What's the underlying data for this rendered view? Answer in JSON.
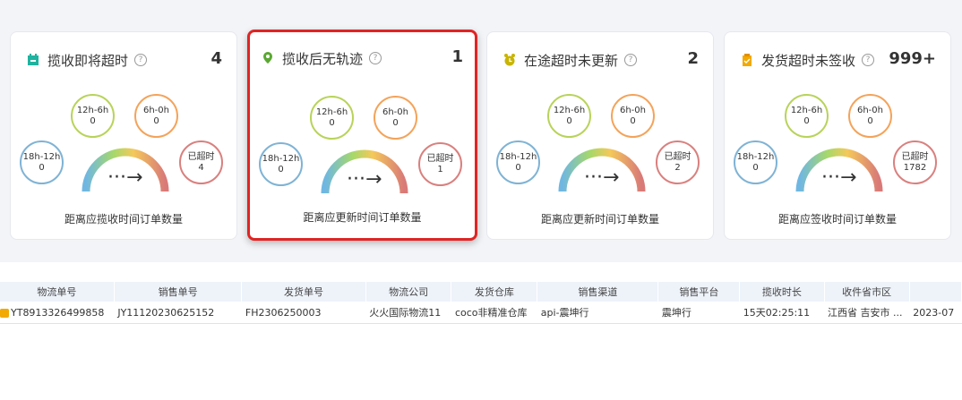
{
  "cards": [
    {
      "title": "揽收即将超时",
      "help": "?",
      "count": "4",
      "caption": "距离应揽收时间订单数量",
      "icon": "calendar-icon",
      "iconColor": "#1fb3a0",
      "buckets": [
        {
          "label": "18h-12h",
          "value": "0"
        },
        {
          "label": "12h-6h",
          "value": "0"
        },
        {
          "label": "6h-0h",
          "value": "0"
        },
        {
          "label": "已超时",
          "value": "4"
        }
      ]
    },
    {
      "title": "揽收后无轨迹",
      "help": "?",
      "count": "1",
      "caption": "距离应更新时间订单数量",
      "icon": "location-pin-icon",
      "iconColor": "#5aa832",
      "buckets": [
        {
          "label": "18h-12h",
          "value": "0"
        },
        {
          "label": "12h-6h",
          "value": "0"
        },
        {
          "label": "6h-0h",
          "value": "0"
        },
        {
          "label": "已超时",
          "value": "1"
        }
      ]
    },
    {
      "title": "在途超时未更新",
      "help": "?",
      "count": "2",
      "caption": "距离应更新时间订单数量",
      "icon": "alarm-clock-icon",
      "iconColor": "#c9b400",
      "buckets": [
        {
          "label": "18h-12h",
          "value": "0"
        },
        {
          "label": "12h-6h",
          "value": "0"
        },
        {
          "label": "6h-0h",
          "value": "0"
        },
        {
          "label": "已超时",
          "value": "2"
        }
      ]
    },
    {
      "title": "发货超时未签收",
      "help": "?",
      "count": "999+",
      "caption": "距离应签收时间订单数量",
      "icon": "clipboard-check-icon",
      "iconColor": "#f2a900",
      "buckets": [
        {
          "label": "18h-12h",
          "value": "0"
        },
        {
          "label": "12h-6h",
          "value": "0"
        },
        {
          "label": "6h-0h",
          "value": "0"
        },
        {
          "label": "已超时",
          "value": "1782"
        }
      ]
    }
  ],
  "arrow": "···→",
  "table": {
    "headers": [
      "物流单号",
      "销售单号",
      "发货单号",
      "物流公司",
      "发货仓库",
      "销售渠道",
      "销售平台",
      "揽收时长",
      "收件省市区",
      ""
    ],
    "rows": [
      [
        "YT8913326499858",
        "JY11120230625152",
        "FH2306250003",
        "火火国际物流11",
        "coco非精准仓库",
        "api-震坤行",
        "震坤行",
        "15天02:25:11",
        "江西省 吉安市 ...",
        "2023-07"
      ]
    ]
  },
  "bucket_colors": {
    "18h-12h": "#7fb3d5",
    "12h-6h": "#b8d35a",
    "6h-0h": "#f4a35a",
    "已超时": "#d9807e"
  }
}
